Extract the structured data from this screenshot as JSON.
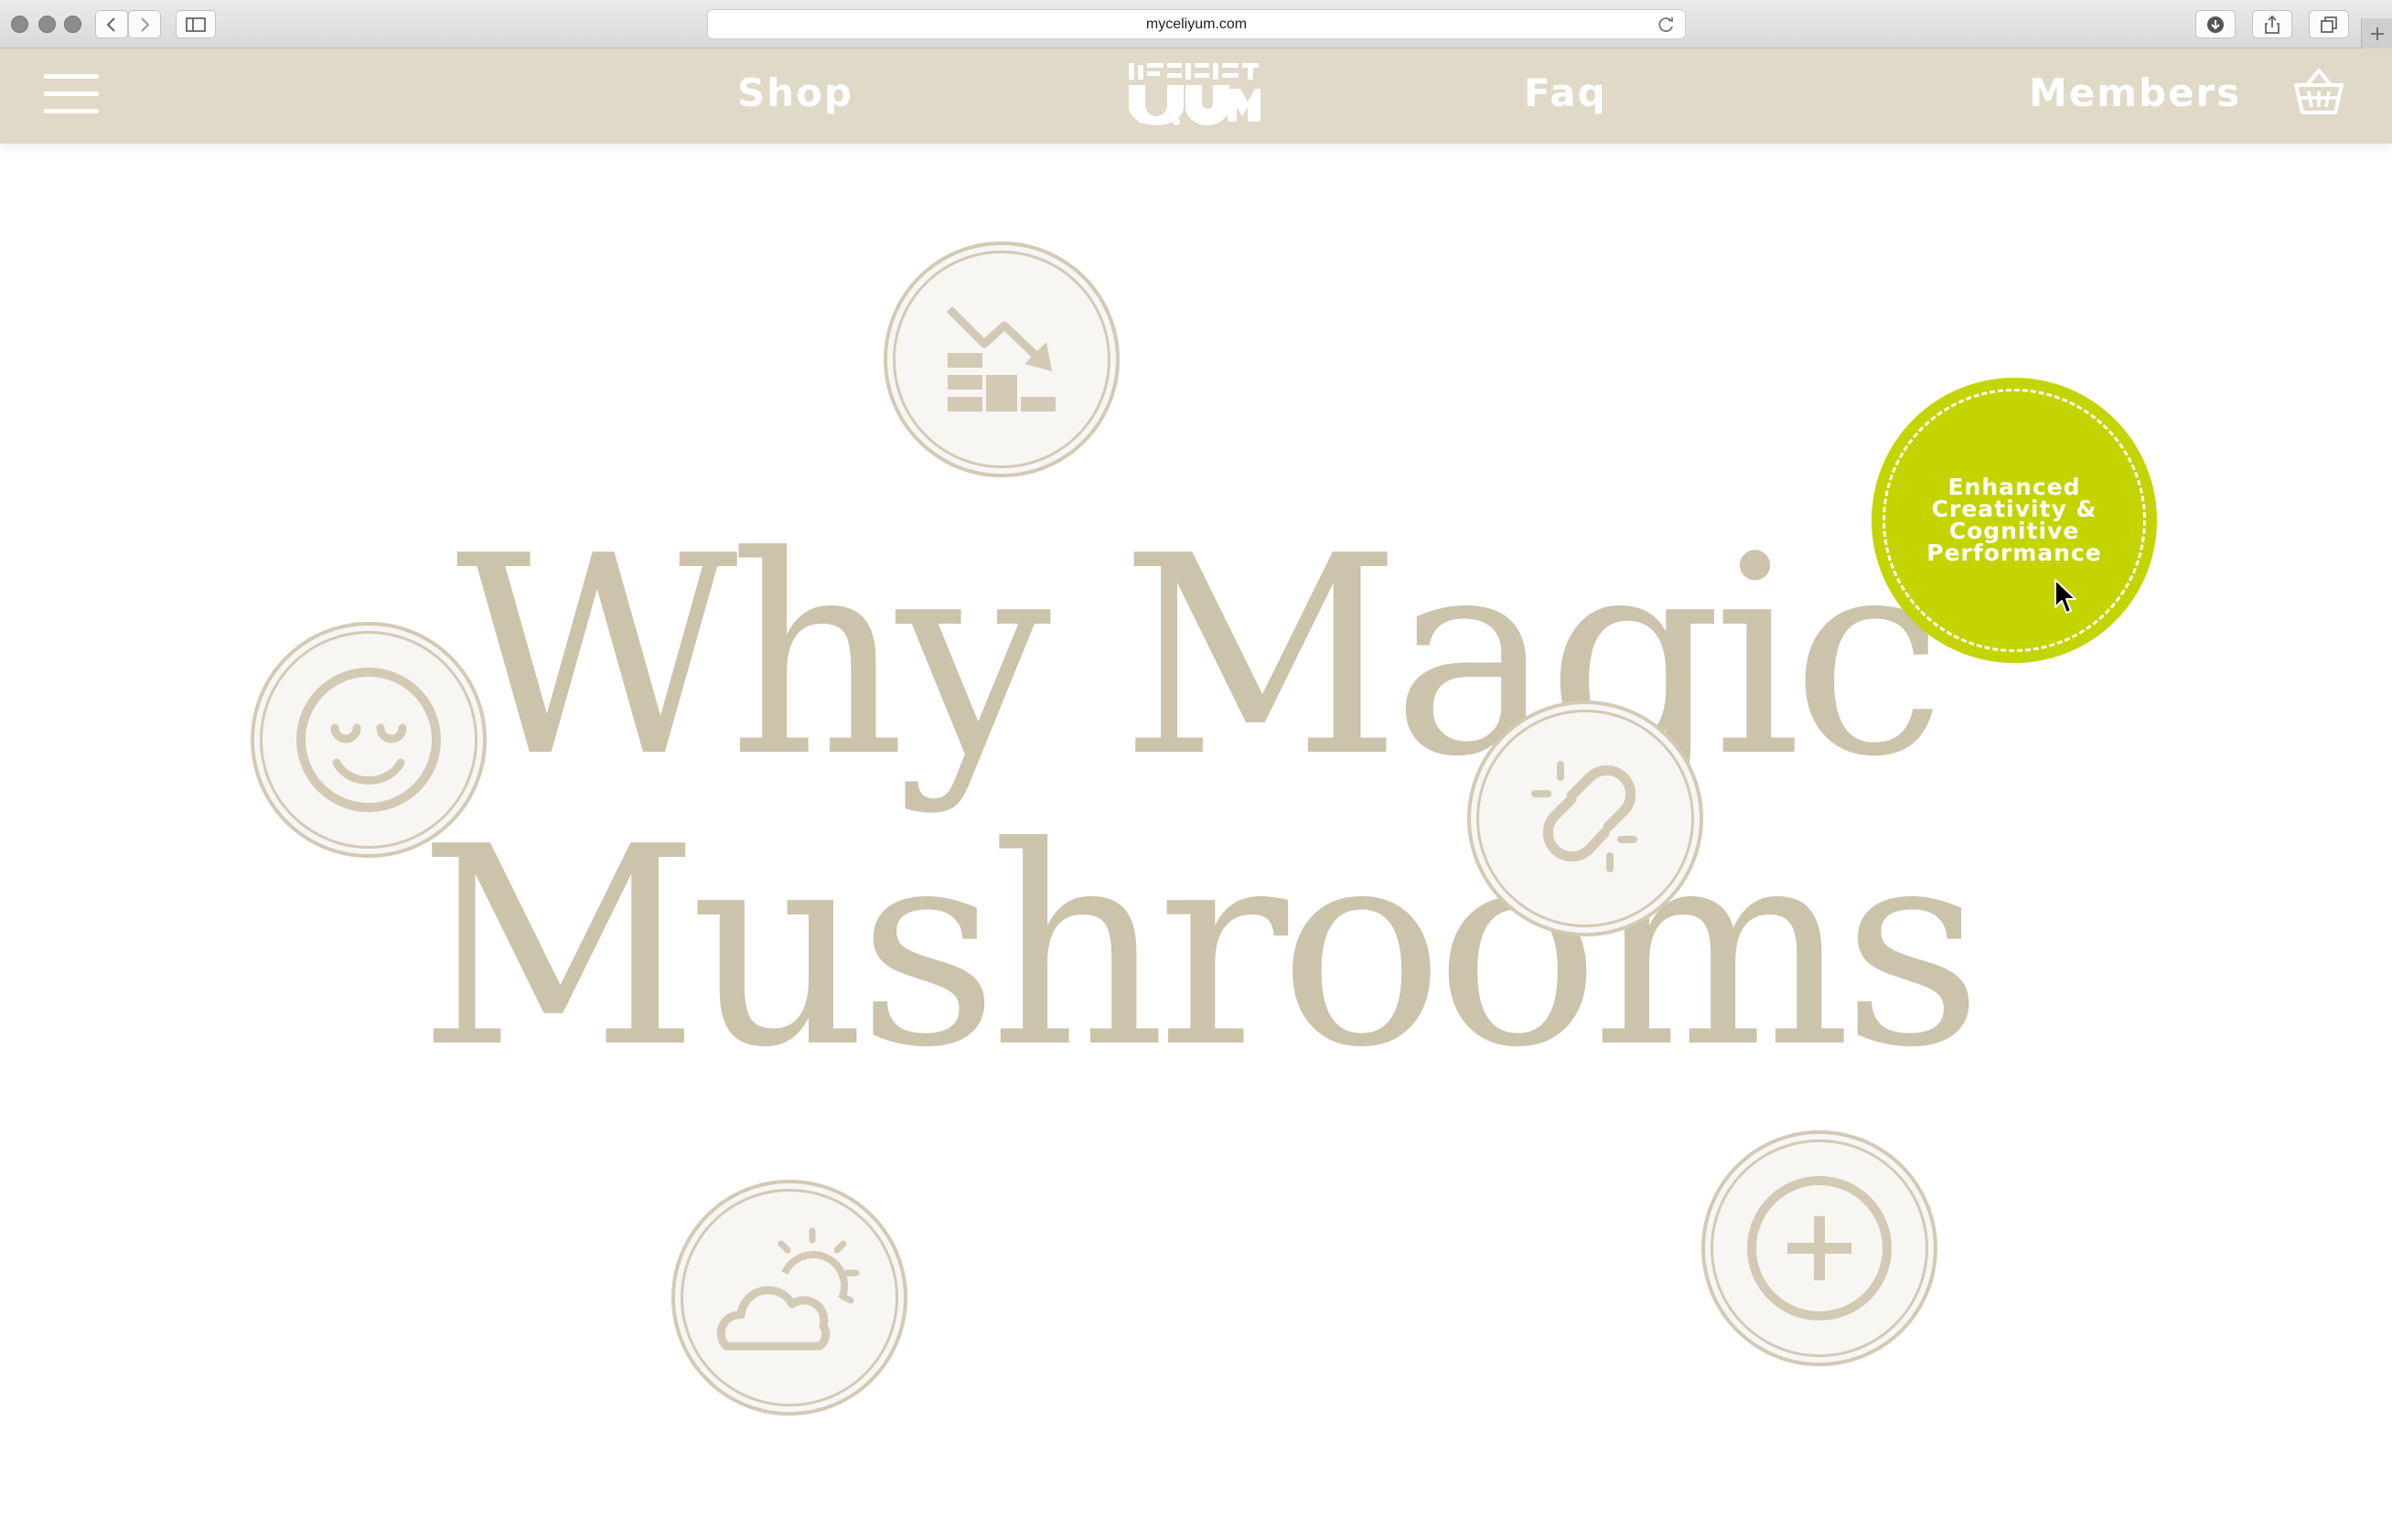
{
  "browser": {
    "url": "myceliyum.com"
  },
  "header": {
    "menu_icon": "hamburger-menu-icon",
    "nav_shop": "Shop",
    "nav_faq": "Faq",
    "nav_members": "Members",
    "logo_text": "MYCELIYUM",
    "cart_icon": "basket-icon"
  },
  "hero": {
    "title_line1": "Why Magic",
    "title_line2": "Mushrooms",
    "benefit_active": "Enhanced Creativity & Cognitive Performance",
    "benefit_icons": [
      "declining-chart-icon",
      "smiley-face-icon",
      "broken-link-icon",
      "sun-cloud-icon",
      "plus-circle-icon"
    ]
  },
  "colors": {
    "header_bg": "#e0d9c8",
    "title_text": "#ccc3ab",
    "badge_bg": "#f8f6f3",
    "badge_stroke": "#d3cab5",
    "accent_green": "#c4d400"
  }
}
